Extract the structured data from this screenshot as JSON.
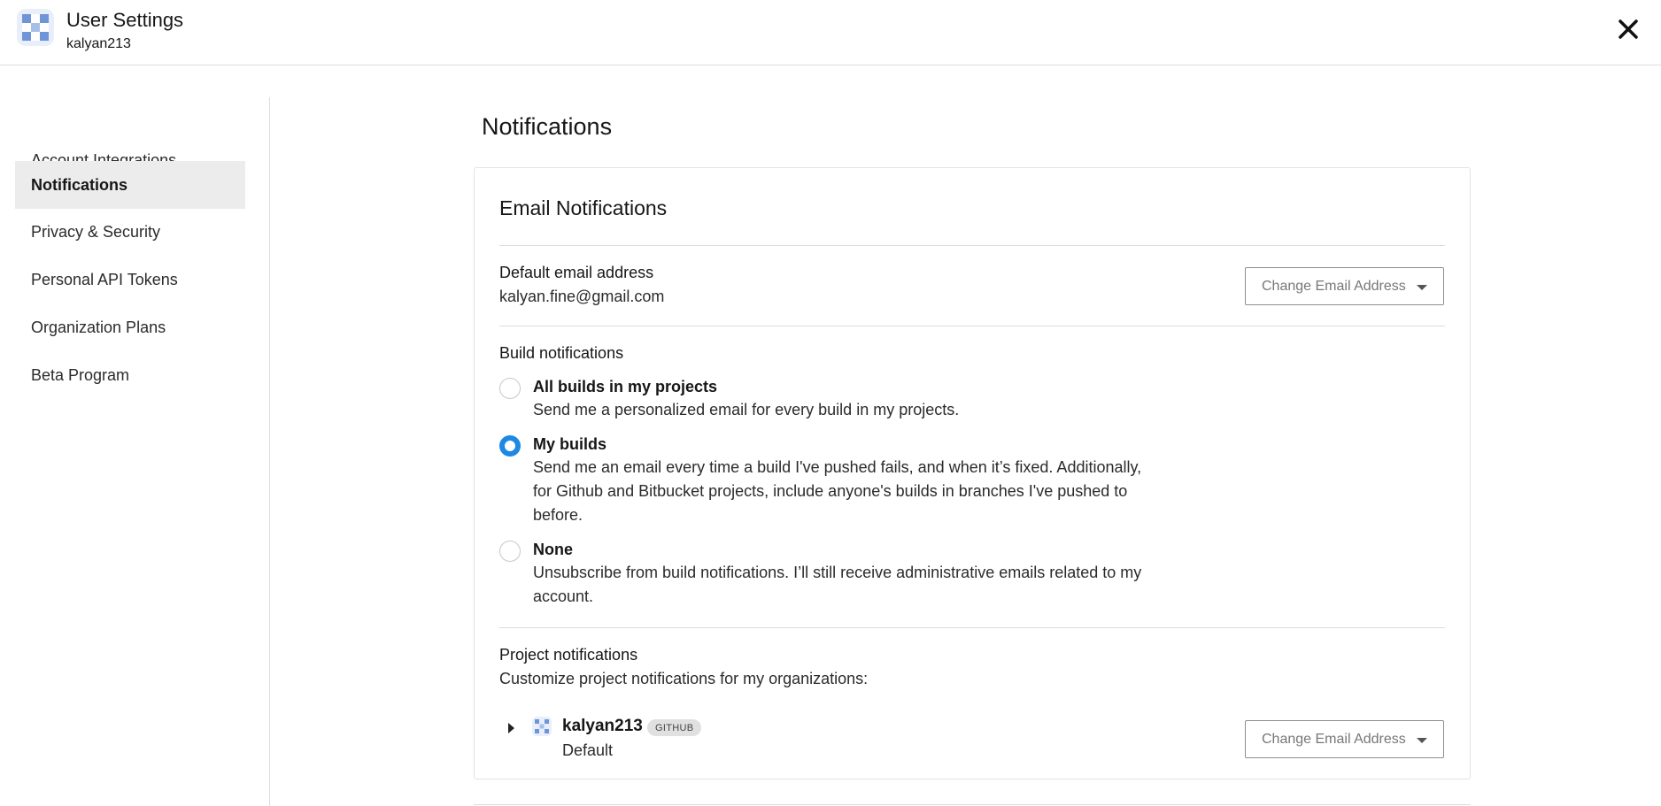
{
  "header": {
    "title": "User Settings",
    "subtitle": "kalyan213",
    "logo_icon": "circleci-logo-icon",
    "close_icon": "close-icon"
  },
  "sidebar": {
    "items": [
      {
        "label": "Account Integrations",
        "active": false
      },
      {
        "label": "Notifications",
        "active": true
      },
      {
        "label": "Privacy & Security",
        "active": false
      },
      {
        "label": "Personal API Tokens",
        "active": false
      },
      {
        "label": "Organization Plans",
        "active": false
      },
      {
        "label": "Beta Program",
        "active": false
      }
    ]
  },
  "main": {
    "title": "Notifications",
    "email_card": {
      "title": "Email Notifications",
      "default_email": {
        "label": "Default email address",
        "value": "kalyan.fine@gmail.com",
        "button_label": "Change Email Address"
      },
      "build_notifications": {
        "label": "Build notifications",
        "options": [
          {
            "title": "All builds in my projects",
            "desc": "Send me a personalized email for every build in my projects.",
            "checked": false
          },
          {
            "title": "My builds",
            "desc": "Send me an email every time a build I've pushed fails, and when it’s fixed. Additionally, for Github and Bitbucket projects, include anyone's builds in branches I've pushed to before.",
            "checked": true
          },
          {
            "title": "None",
            "desc": "Unsubscribe from build notifications. I’ll still receive administrative emails related to my account.",
            "checked": false
          }
        ]
      },
      "project_notifications": {
        "label": "Project notifications",
        "desc": "Customize project notifications for my organizations:",
        "org": {
          "name": "kalyan213",
          "badge": "GITHUB",
          "setting": "Default",
          "button_label": "Change Email Address"
        }
      }
    }
  },
  "colors": {
    "accent": "#1e88e5",
    "active_nav_bg": "#ececec",
    "divider": "#dcdcdc"
  }
}
